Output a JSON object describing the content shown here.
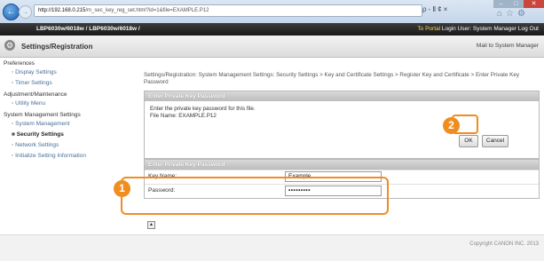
{
  "browser": {
    "back_icon": "back-arrow-icon",
    "forward_icon": "forward-arrow-icon",
    "url_domain": "http://192.168.0.215",
    "url_path": "/m_sec_key_reg_set.html?id=1&file=EXAMPLE.P12",
    "address_tools": "ρ-Ⅱ¢×",
    "window_min": "–",
    "window_max": "□",
    "window_close": "✕",
    "tab_icons": "⌂☆⚙"
  },
  "topbar": {
    "device": "LBP6030w/6018w / LBP6030w/6018w /",
    "portal": "To Portal",
    "login": "Login User: System Manager Log Out"
  },
  "titlebar": {
    "title": "Settings/Registration",
    "mail": "Mail to System Manager"
  },
  "sidebar": {
    "cat1": "Preferences",
    "item_display": "Display Settings",
    "item_timer": "Timer Settings",
    "cat2": "Adjustment/Maintenance",
    "item_utility": "Utility Menu",
    "cat3": "System Management Settings",
    "item_system": "System Management",
    "item_security": "Security Settings",
    "item_network": "Network Settings",
    "item_init": "Initialize Setting Information"
  },
  "main": {
    "breadcrumb": "Settings/Registration: System Management Settings: Security Settings > Key and Certificate Settings > Register Key and Certificate > Enter Private Key Password",
    "panel1_header": "Enter Private Key Password",
    "message1": "Enter the private key password for this file.",
    "message2": "File Name: EXAMPLE.P12",
    "ok": "OK",
    "cancel": "Cancel",
    "panel2_header": "Enter Private Key Password",
    "key_name_label": "Key Name:",
    "key_name_value": "Example",
    "password_label": "Password:",
    "password_value": "•••••••••",
    "scroll_icon": "▲"
  },
  "callouts": {
    "one": "1",
    "two": "2"
  },
  "footer": {
    "copyright": "Copyright CANON INC. 2013"
  }
}
